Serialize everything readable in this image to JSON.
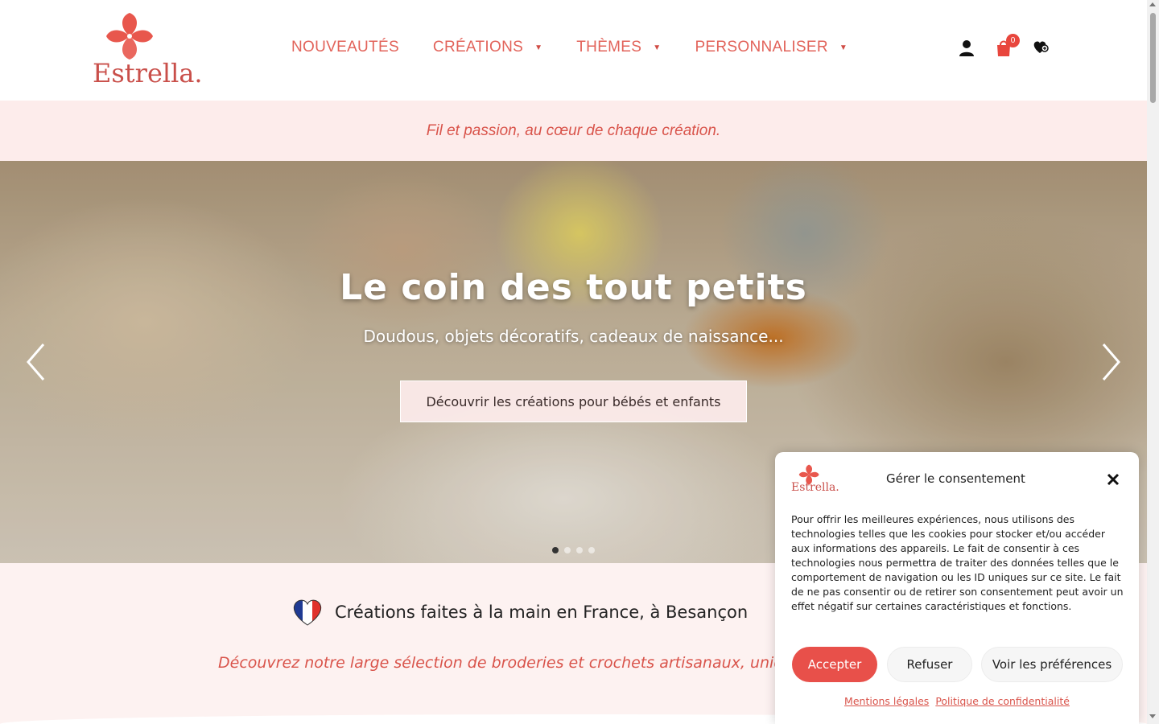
{
  "brand": {
    "name": "Estrella",
    "logo_text": "Estrella.",
    "accent_color": "#e2635a",
    "badge_color": "#e8463d"
  },
  "nav": {
    "items": [
      {
        "label": "NOUVEAUTÉS",
        "has_dropdown": false
      },
      {
        "label": "CRÉATIONS",
        "has_dropdown": true
      },
      {
        "label": "THÈMES",
        "has_dropdown": true
      },
      {
        "label": "PERSONNALISER",
        "has_dropdown": true
      }
    ]
  },
  "header_icons": {
    "account_icon": "user-icon",
    "cart_icon": "shopping-bag-icon",
    "cart_count": "0",
    "wishlist_icon": "heart-icon"
  },
  "tagline": "Fil et passion, au cœur de chaque création.",
  "hero": {
    "title": "Le coin des tout petits",
    "subtitle": "Doudous, objets décoratifs, cadeaux de naissance...",
    "cta_label": "Découvrir les créations pour bébés et enfants",
    "slide_count": 4,
    "active_slide": 1
  },
  "section": {
    "made_in": "Créations faites à la main en France, à Besançon",
    "discover": "Découvrez notre large sélection de broderies et crochets artisanaux, uniques"
  },
  "consent": {
    "title": "Gérer le consentement",
    "body": "Pour offrir les meilleures expériences, nous utilisons des technologies telles que les cookies pour stocker et/ou accéder aux informations des appareils. Le fait de consentir à ces technologies nous permettra de traiter des données telles que le comportement de navigation ou les ID uniques sur ce site. Le fait de ne pas consentir ou de retirer son consentement peut avoir un effet négatif sur certaines caractéristiques et fonctions.",
    "accept_label": "Accepter",
    "refuse_label": "Refuser",
    "prefs_label": "Voir les préférences",
    "legal_link": "Mentions légales",
    "privacy_link": "Politique de confidentialité",
    "logo_text": "Estrella."
  }
}
